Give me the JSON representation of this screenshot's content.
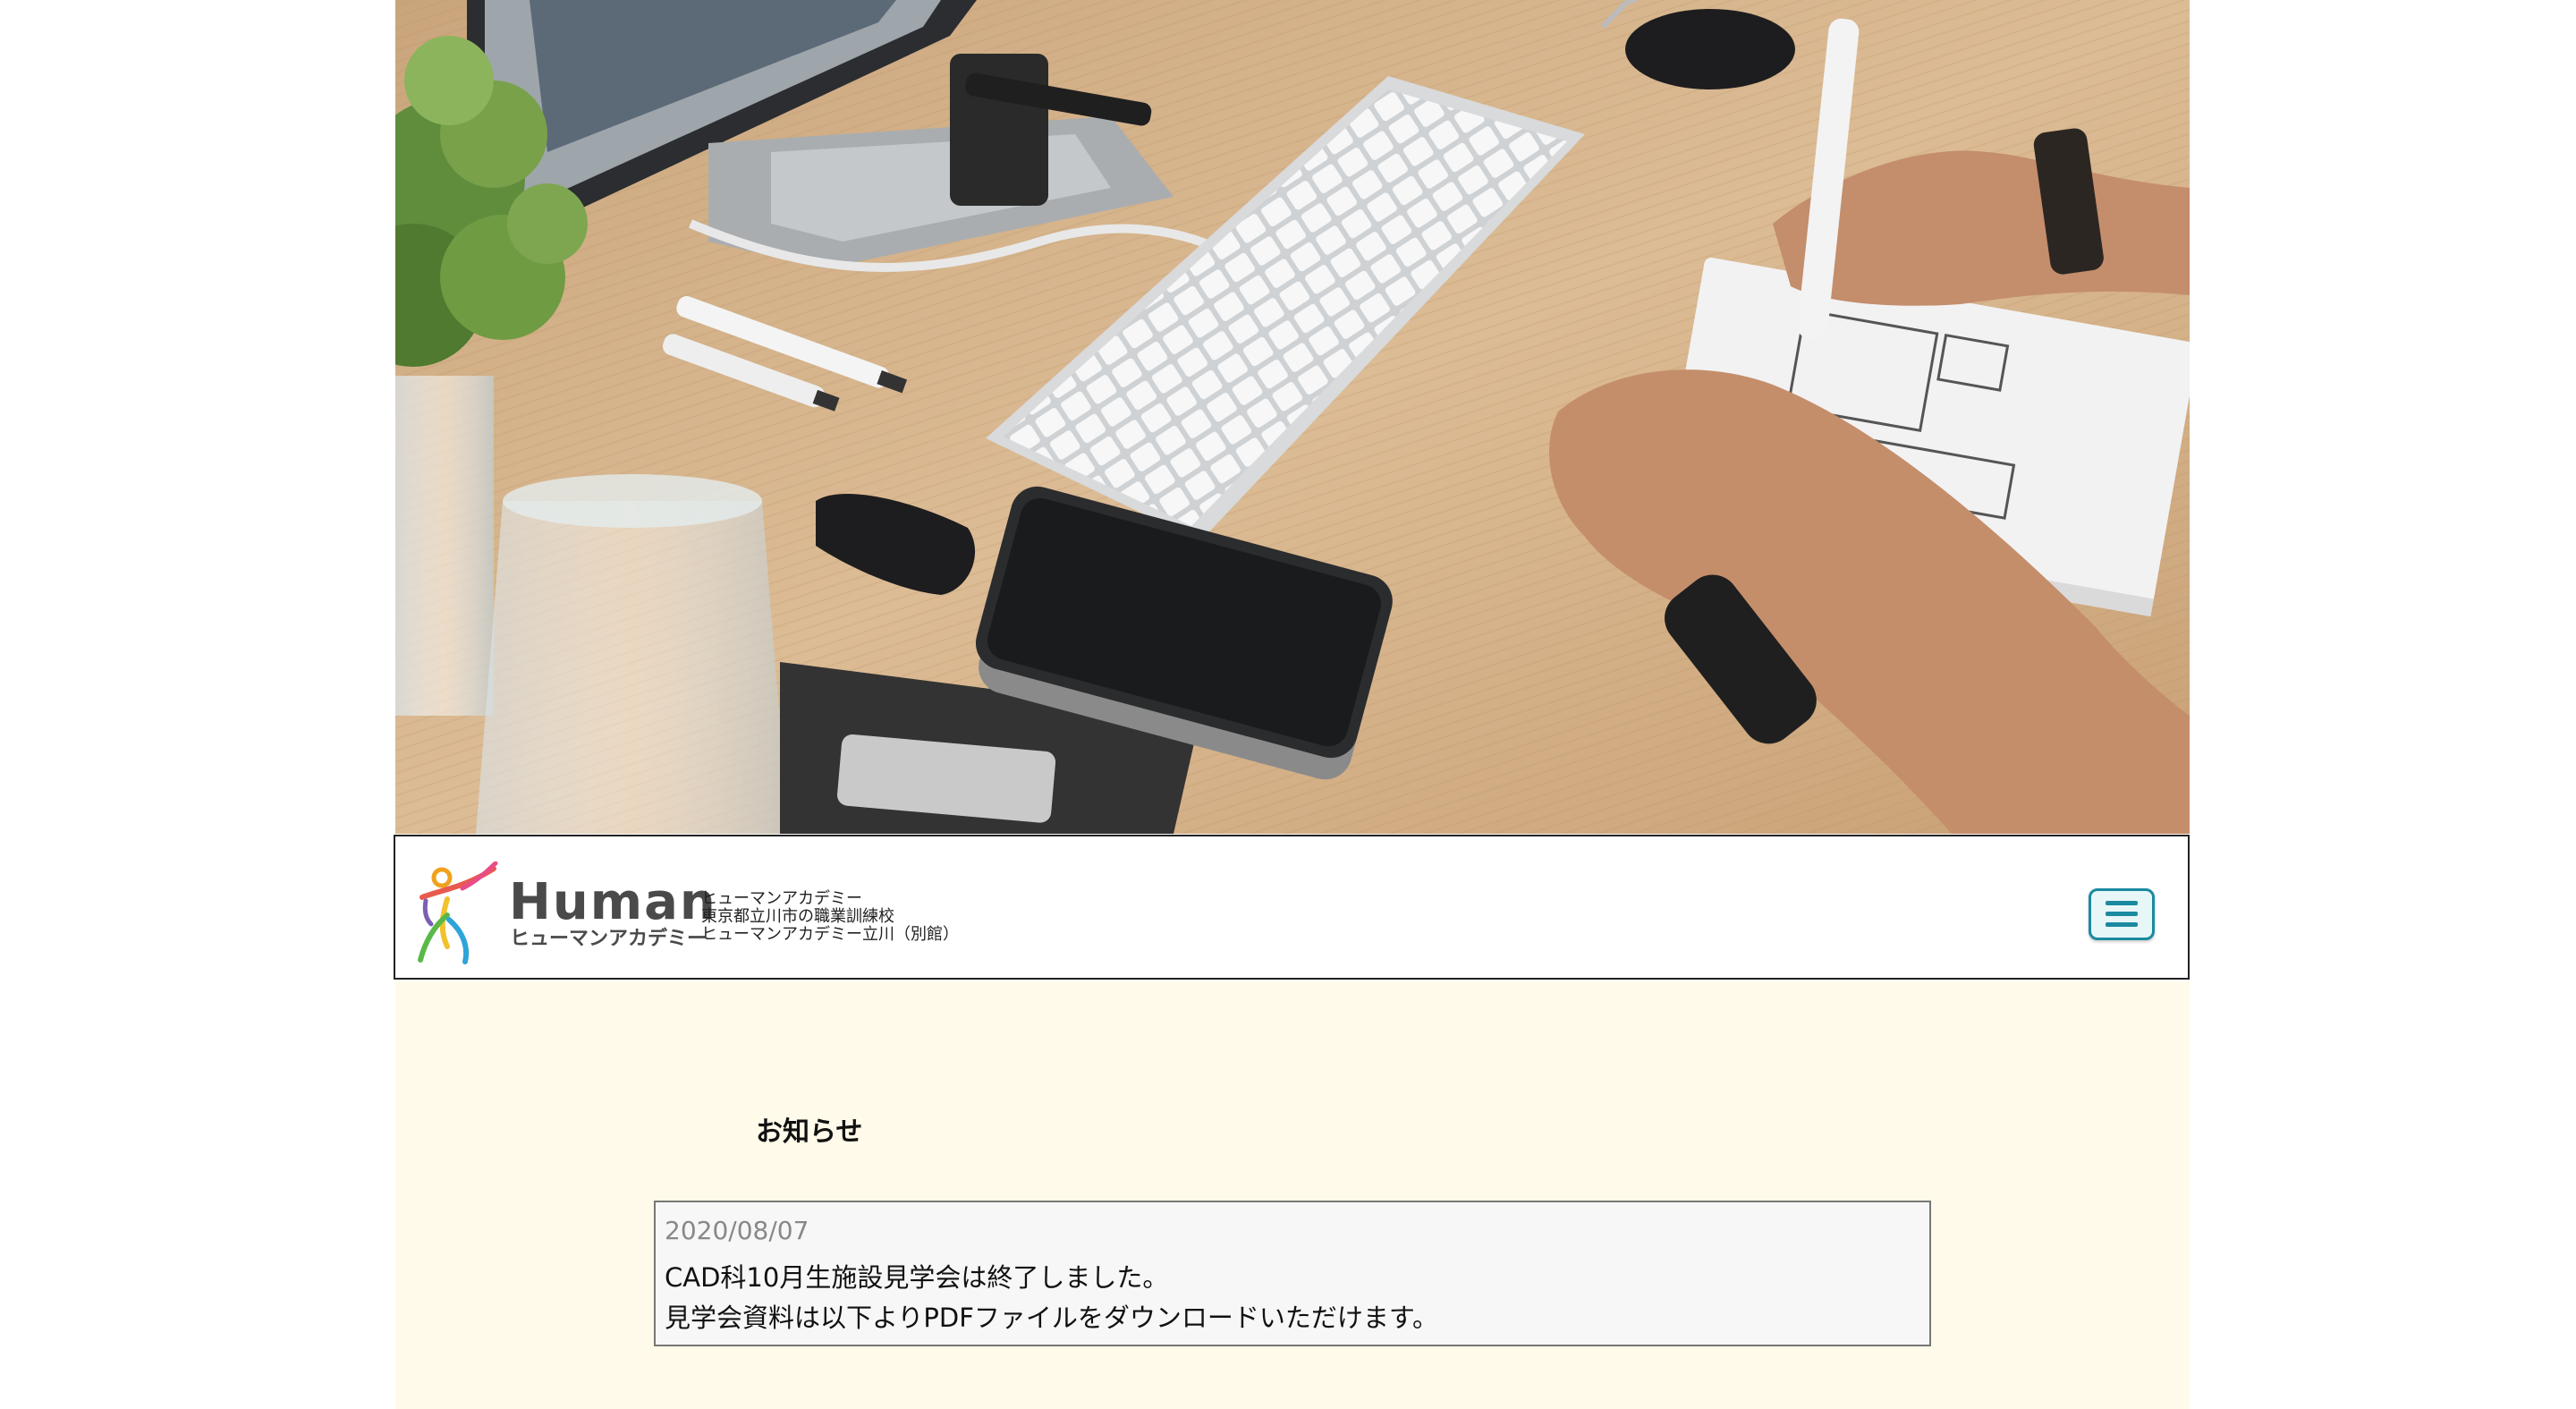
{
  "hero": {
    "image": "desk-workspace-photo"
  },
  "header": {
    "brand_word": "Human",
    "brand_sub": "ヒューマンアカデミー",
    "info_lines": [
      "ヒューマンアカデミー",
      "東京都立川市の職業訓練校",
      "ヒューマンアカデミー立川（別館）"
    ],
    "menu_icon": "hamburger-menu-icon"
  },
  "news": {
    "section_title": "お知らせ",
    "items": [
      {
        "date": "2020/08/07",
        "lines": [
          "CAD科10月生施設見学会は終了しました。",
          "見学会資料は以下よりPDFファイルをダウンロードいただけます。"
        ]
      }
    ]
  },
  "colors": {
    "content_bg": "#fffaea",
    "menu_accent": "#1a8aa0",
    "card_bg": "#f7f7f7"
  }
}
